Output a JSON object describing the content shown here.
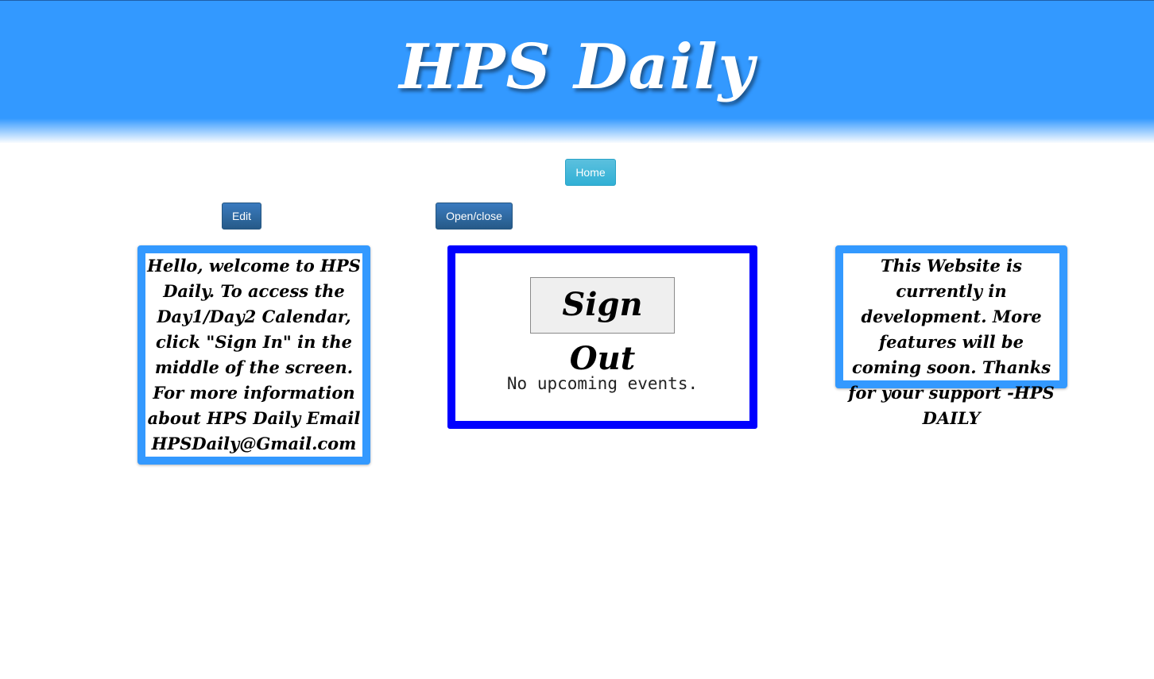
{
  "header": {
    "title": "HPS Daily"
  },
  "nav": {
    "home_label": "Home"
  },
  "toolbar": {
    "edit_label": "Edit",
    "toggle_label": "Open/close"
  },
  "welcome_card": {
    "text": "Hello, welcome to HPS Daily. To access the Day1/Day2 Calendar, click \"Sign In\" in the middle of the screen. For more information about HPS Daily Email HPSDaily@Gmail.com"
  },
  "center_card": {
    "signout_label": "Sign Out",
    "events_text": "No upcoming events."
  },
  "dev_card": {
    "text": "This Website is currently in development. More features will be coming soon. Thanks for your support -HPS DAILY"
  },
  "colors": {
    "header_blue": "#3399ff",
    "card_border_blue": "#3399ff",
    "center_border": "#0000ff",
    "home_button": "#5bc0de",
    "primary_button": "#265a88"
  }
}
